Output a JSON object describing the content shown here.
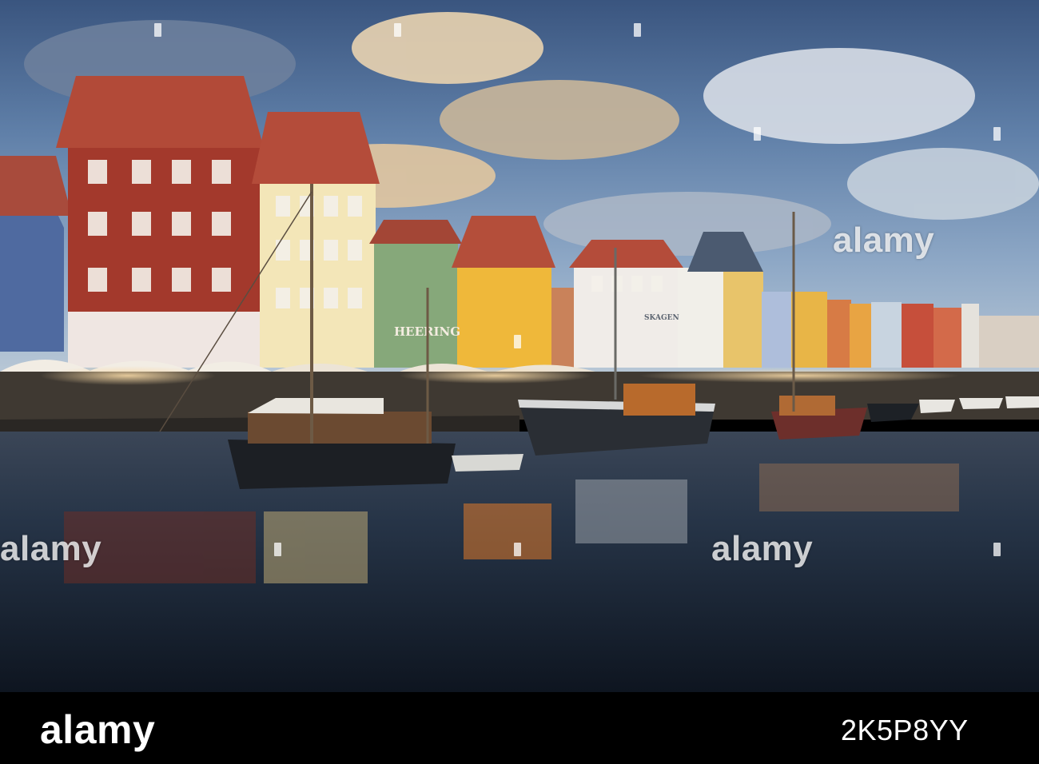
{
  "image": {
    "scene": "Nyhavn harbour, Copenhagen, at dusk"
  },
  "signs": {
    "heering": "HEERING",
    "skagen": "SKAGEN"
  },
  "watermark": {
    "text": "alamy"
  },
  "footer": {
    "logo": "alamy",
    "image_code": "2K5P8YY"
  },
  "colors": {
    "sky_top": "#3b5a86",
    "sky_mid": "#6f8db3",
    "water": "#1e2a3a",
    "footer_bg": "#000000"
  }
}
